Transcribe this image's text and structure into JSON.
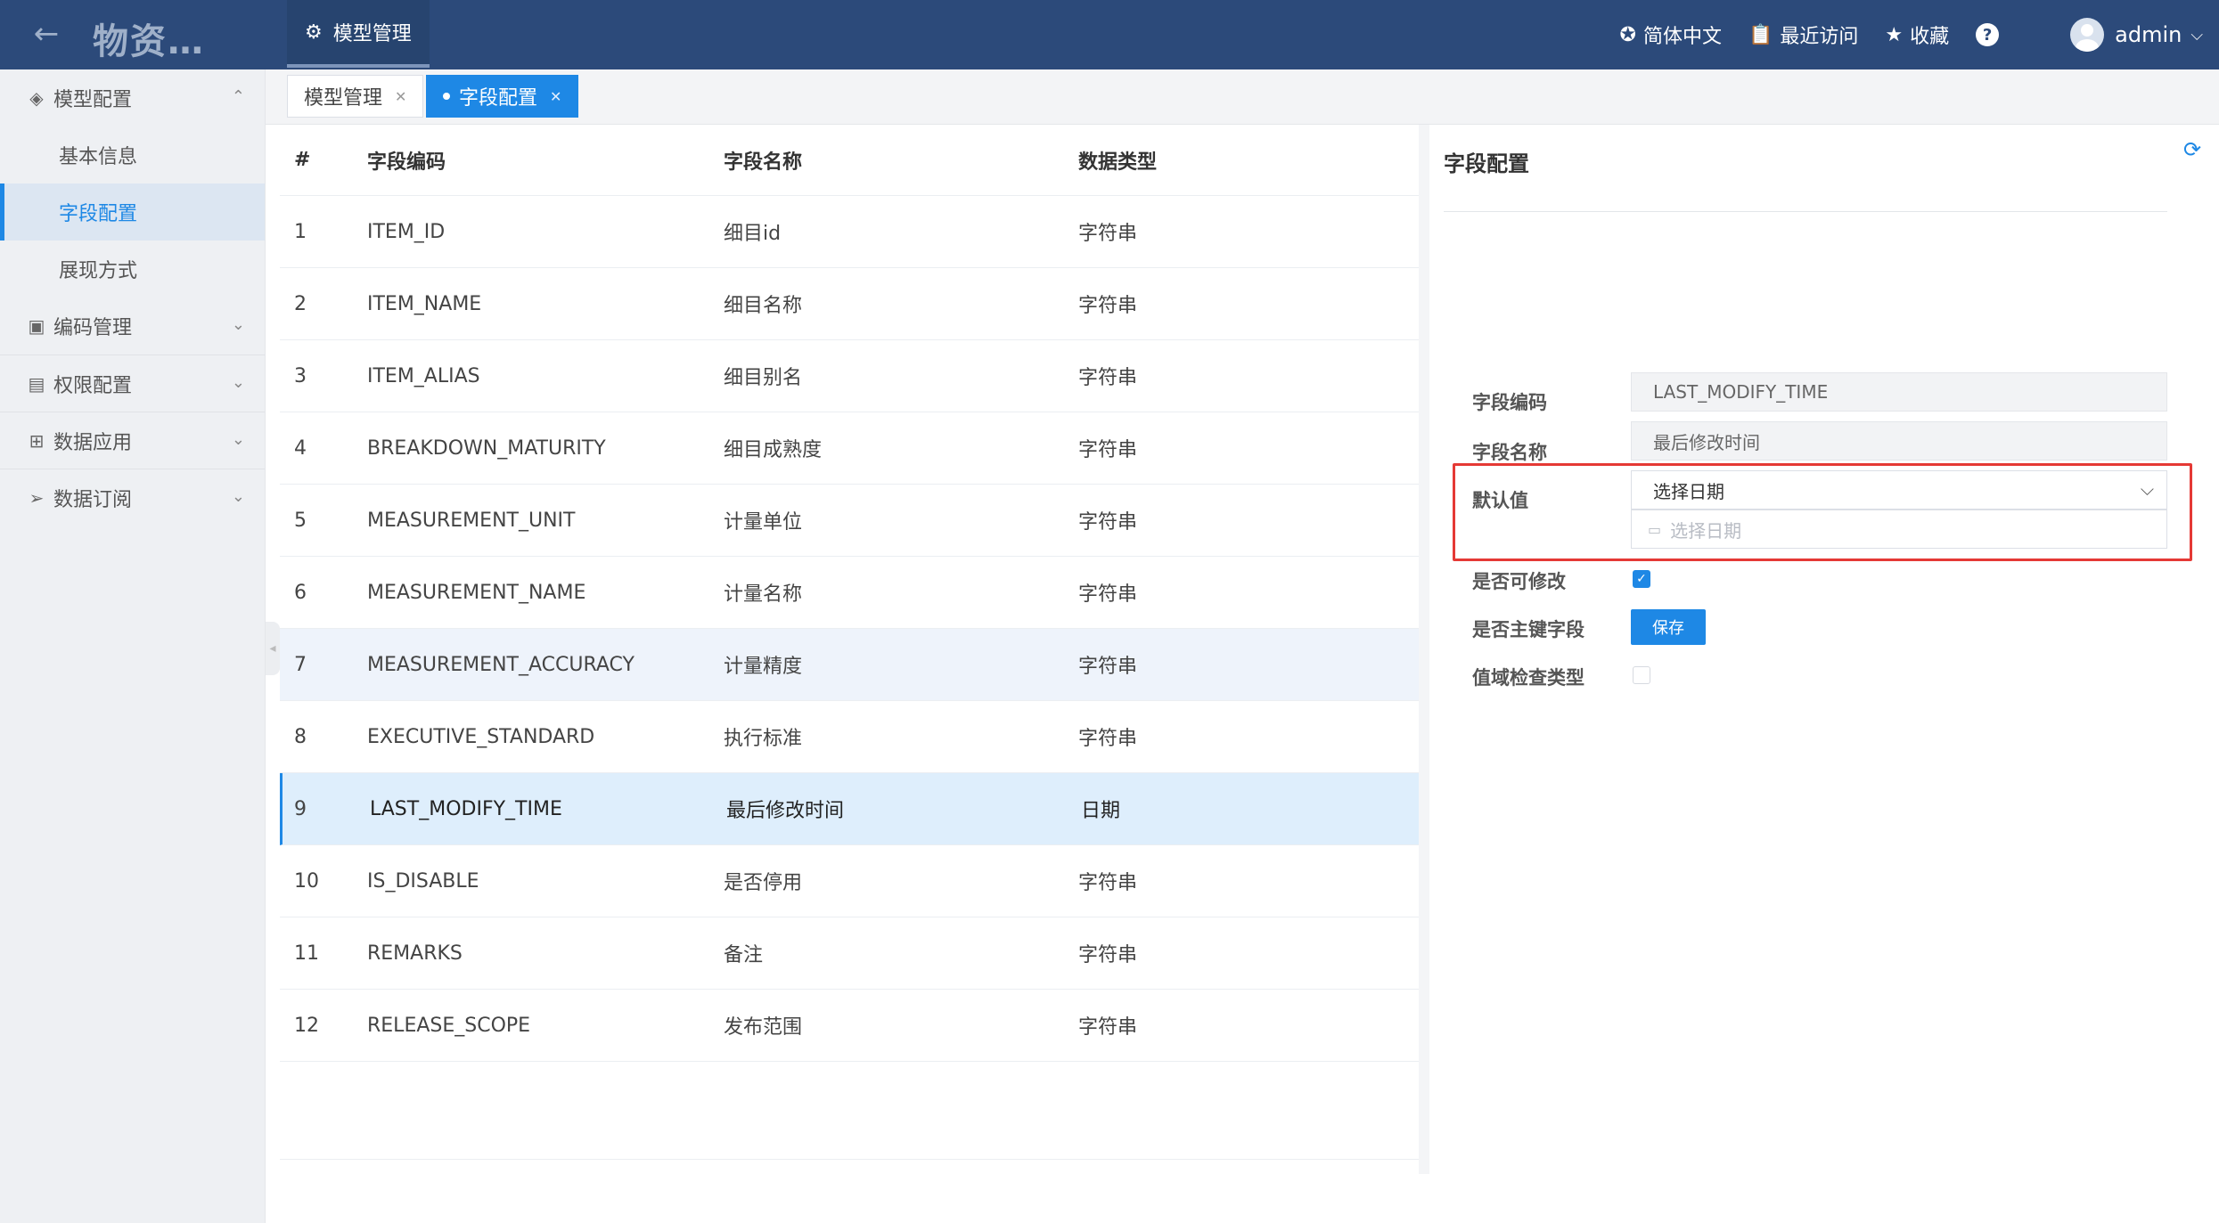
{
  "header": {
    "app_title": "物资…",
    "top_tab": "模型管理",
    "language": "简体中文",
    "recent": "最近访问",
    "favorites": "收藏",
    "help": "?",
    "username": "admin"
  },
  "sidebar": {
    "groups": [
      {
        "label": "模型配置",
        "icon": "layers-icon",
        "expanded": true,
        "items": [
          {
            "label": "基本信息"
          },
          {
            "label": "字段配置",
            "active": true
          },
          {
            "label": "展现方式"
          }
        ]
      },
      {
        "label": "编码管理",
        "icon": "chart-icon"
      },
      {
        "label": "权限配置",
        "icon": "permission-icon"
      },
      {
        "label": "数据应用",
        "icon": "grid-icon"
      },
      {
        "label": "数据订阅",
        "icon": "send-icon"
      }
    ]
  },
  "tabs": [
    {
      "label": "模型管理",
      "active": false
    },
    {
      "label": "字段配置",
      "active": true
    }
  ],
  "table": {
    "headers": {
      "num": "#",
      "code": "字段编码",
      "name": "字段名称",
      "type": "数据类型"
    },
    "rows": [
      {
        "num": "1",
        "code": "ITEM_ID",
        "name": "细目id",
        "type": "字符串"
      },
      {
        "num": "2",
        "code": "ITEM_NAME",
        "name": "细目名称",
        "type": "字符串"
      },
      {
        "num": "3",
        "code": "ITEM_ALIAS",
        "name": "细目别名",
        "type": "字符串"
      },
      {
        "num": "4",
        "code": "BREAKDOWN_MATURITY",
        "name": "细目成熟度",
        "type": "字符串"
      },
      {
        "num": "5",
        "code": "MEASUREMENT_UNIT",
        "name": "计量单位",
        "type": "字符串"
      },
      {
        "num": "6",
        "code": "MEASUREMENT_NAME",
        "name": "计量名称",
        "type": "字符串"
      },
      {
        "num": "7",
        "code": "MEASUREMENT_ACCURACY",
        "name": "计量精度",
        "type": "字符串"
      },
      {
        "num": "8",
        "code": "EXECUTIVE_STANDARD",
        "name": "执行标准",
        "type": "字符串"
      },
      {
        "num": "9",
        "code": "LAST_MODIFY_TIME",
        "name": "最后修改时间",
        "type": "日期"
      },
      {
        "num": "10",
        "code": "IS_DISABLE",
        "name": "是否停用",
        "type": "字符串"
      },
      {
        "num": "11",
        "code": "REMARKS",
        "name": "备注",
        "type": "字符串"
      },
      {
        "num": "12",
        "code": "RELEASE_SCOPE",
        "name": "发布范围",
        "type": "字符串"
      }
    ],
    "hover_row": 7,
    "selected_row": 9
  },
  "panel": {
    "title": "字段配置",
    "field_code_label": "字段编码",
    "field_code_value": "LAST_MODIFY_TIME",
    "field_name_label": "字段名称",
    "field_name_value": "最后修改时间",
    "default_label": "默认值",
    "default_select_value": "选择日期",
    "date_placeholder": "选择日期",
    "editable_label": "是否可修改",
    "editable_checked": true,
    "primary_key_label": "是否主键字段",
    "primary_key_checked": false,
    "domain_check_label": "值域检查类型",
    "domain_check_checked": false,
    "save_label": "保存"
  },
  "colors": {
    "header_bg": "#2c4a7a",
    "accent": "#1e88e5",
    "highlight_border": "#e53935"
  }
}
